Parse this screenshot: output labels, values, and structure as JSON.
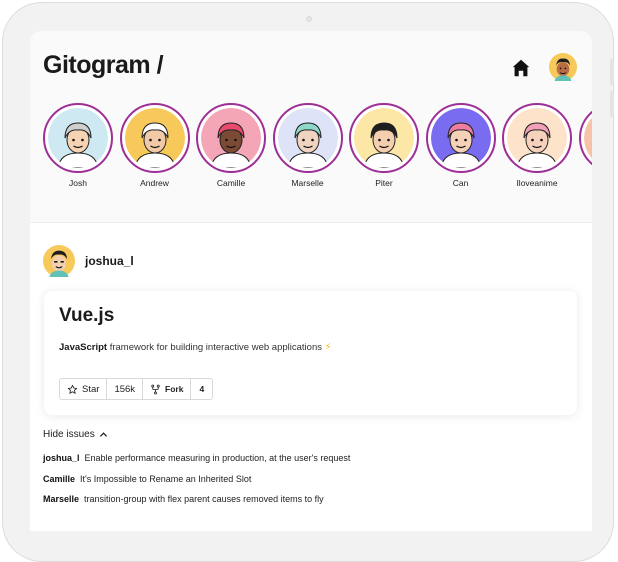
{
  "header": {
    "logo": "Gitogram /",
    "home_icon": "home-icon",
    "avatar_icon": "user-avatar"
  },
  "stories": [
    {
      "name": "Josh",
      "bg": "#cfe9f2",
      "skin": "#f5d3b3",
      "hair": "#cfcfcf"
    },
    {
      "name": "Andrew",
      "bg": "#f6c95a",
      "skin": "#f2c9a6",
      "hair": "#ffffff"
    },
    {
      "name": "Camille",
      "bg": "#f4a6b6",
      "skin": "#7a4a34",
      "hair": "#e84a6c"
    },
    {
      "name": "Marselle",
      "bg": "#dfe3f7",
      "skin": "#f1d4c0",
      "hair": "#8ed7c9"
    },
    {
      "name": "Piter",
      "bg": "#fde7a6",
      "skin": "#f3cfb0",
      "hair": "#1e1e1e"
    },
    {
      "name": "Can",
      "bg": "#7a6cf0",
      "skin": "#f5d1b8",
      "hair": "#ef7da1"
    },
    {
      "name": "Iloveanime",
      "bg": "#fde3c9",
      "skin": "#f6d2bd",
      "hair": "#f2a0b8"
    },
    {
      "name": "",
      "bg": "#f7c3a8",
      "skin": "#f6d2bd",
      "hair": "#f2a0b8"
    }
  ],
  "post": {
    "username": "joshua_l",
    "repo": {
      "title": "Vue.js",
      "language": "JavaScript",
      "description": " framework for building interactive web applications ",
      "bolt": "⚡",
      "star_label": "Star",
      "star_count": "156k",
      "fork_label": "Fork",
      "fork_count": "4"
    },
    "toggle_label": "Hide issues",
    "issues": [
      {
        "author": "joshua_l",
        "text": "Enable performance measuring in production, at the user's request"
      },
      {
        "author": "Camille",
        "text": "It's Impossible to Rename an Inherited Slot"
      },
      {
        "author": "Marselle",
        "text": "transition-group with flex parent causes removed items to fly"
      }
    ]
  },
  "colors": {
    "story_ring": "#9d2f96",
    "accent_bolt": "#f4c21c"
  }
}
